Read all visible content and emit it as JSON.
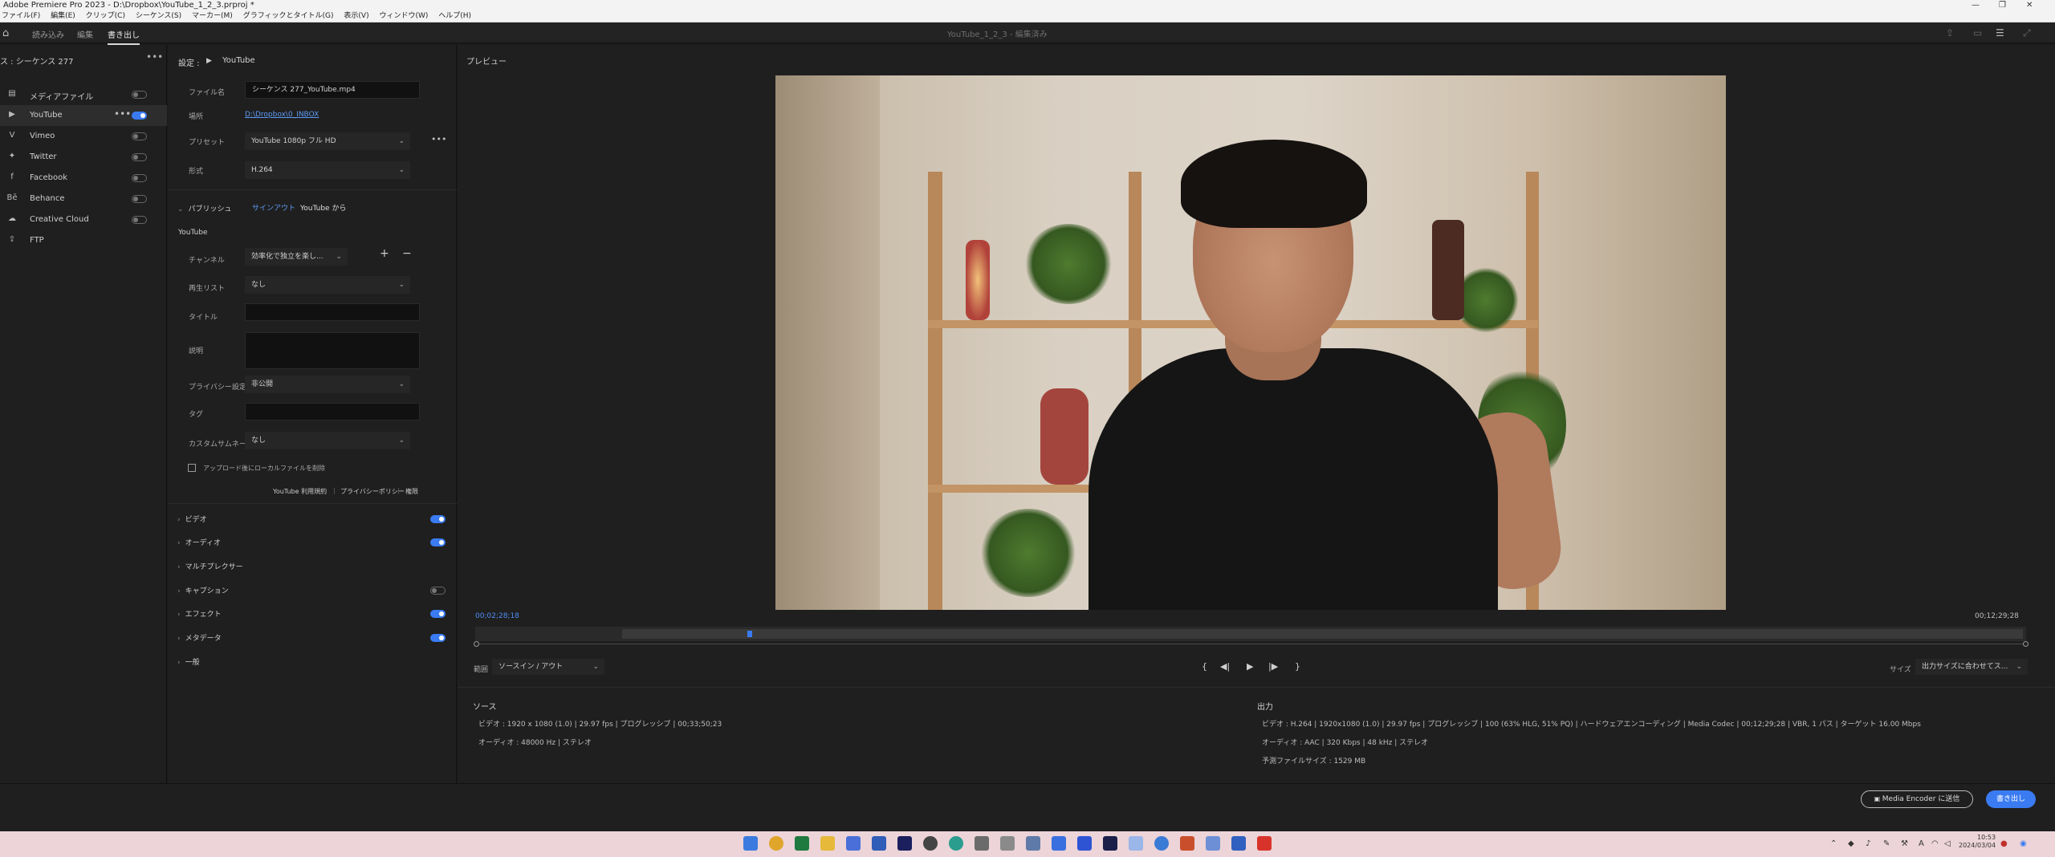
{
  "titlebar": {
    "title": "Adobe Premiere Pro 2023 - D:\\Dropbox\\YouTube_1_2_3.prproj *"
  },
  "menubar": {
    "items": [
      "ファイル(F)",
      "編集(E)",
      "クリップ(C)",
      "シーケンス(S)",
      "マーカー(M)",
      "グラフィックとタイトル(G)",
      "表示(V)",
      "ウィンドウ(W)",
      "ヘルプ(H)"
    ]
  },
  "workspace": {
    "tabs": [
      "読み込み",
      "編集",
      "書き出し"
    ],
    "active": "書き出し",
    "doc_title": "YouTube_1_2_3 - 編集済み"
  },
  "left": {
    "header": "ス : シーケンス 277",
    "destinations": [
      {
        "label": "メディアファイル",
        "icon": "file-icon",
        "toggle": false
      },
      {
        "label": "YouTube",
        "icon": "youtube-icon",
        "toggle": true,
        "active": true
      },
      {
        "label": "Vimeo",
        "icon": "vimeo-icon",
        "toggle": false
      },
      {
        "label": "Twitter",
        "icon": "twitter-icon",
        "toggle": false
      },
      {
        "label": "Facebook",
        "icon": "facebook-icon",
        "toggle": false
      },
      {
        "label": "Behance",
        "icon": "behance-icon",
        "toggle": false
      },
      {
        "label": "Creative Cloud",
        "icon": "creative-cloud-icon",
        "toggle": false
      },
      {
        "label": "FTP",
        "icon": "ftp-icon",
        "toggle": false
      }
    ]
  },
  "settings": {
    "header_prefix": "設定 :",
    "header_dest": "YouTube",
    "filename_label": "ファイル名",
    "filename_value": "シーケンス 277_YouTube.mp4",
    "location_label": "場所",
    "location_value": "D:\\Dropbox\\0_INBOX",
    "preset_label": "プリセット",
    "preset_value": "YouTube 1080p フル HD",
    "format_label": "形式",
    "format_value": "H.264",
    "publish": {
      "section": "パブリッシュ",
      "signout": "サインアウト",
      "from": "YouTube から",
      "sub": "YouTube",
      "channel_label": "チャンネル",
      "channel_value": "効率化で独立を楽し...",
      "playlist_label": "再生リスト",
      "playlist_value": "なし",
      "title_label": "タイトル",
      "desc_label": "説明",
      "privacy_label": "プライバシー設定",
      "privacy_value": "非公開",
      "tag_label": "タグ",
      "thumb_label": "カスタムサムネール",
      "thumb_value": "なし",
      "delete_local": "アップロード後にローカルファイルを削除",
      "links": [
        "YouTube 利用規約",
        "プライバシーポリシー",
        "権限"
      ]
    },
    "sections": [
      {
        "label": "ビデオ",
        "toggle": true
      },
      {
        "label": "オーディオ",
        "toggle": true
      },
      {
        "label": "マルチプレクサー",
        "toggle": null
      },
      {
        "label": "キャプション",
        "toggle": false
      },
      {
        "label": "エフェクト",
        "toggle": true
      },
      {
        "label": "メタデータ",
        "toggle": true
      },
      {
        "label": "一般",
        "toggle": null
      }
    ]
  },
  "preview": {
    "title": "プレビュー",
    "current_time": "00;02;28;18",
    "duration": "00;12;29;28",
    "range_label": "範囲",
    "range_value": "ソースイン / アウト",
    "size_label": "サイズ",
    "size_value": "出力サイズに合わせてス..."
  },
  "source": {
    "heading": "ソース",
    "video": "ビデオ :  1920 x 1080 (1.0)  |  29.97 fps  |  プログレッシブ  |  00;33;50;23",
    "audio": "オーディオ :  48000 Hz  |  ステレオ"
  },
  "output": {
    "heading": "出力",
    "video": "ビデオ :  H.264  |  1920x1080 (1.0)  |  29.97 fps  |  プログレッシブ  |  100 (63% HLG, 51% PQ)  |  ハードウェアエンコーディング  |  Media Codec  |  00;12;29;28  |  VBR, 1 パス  |  ターゲット 16.00 Mbps",
    "audio": "オーディオ :  AAC  |  320 Kbps  |  48 kHz  |  ステレオ",
    "size": "予測ファイルサイズ :  1529 MB"
  },
  "footer": {
    "media_encoder": "Media Encoder に送信",
    "export": "書き出し"
  },
  "taskbar": {
    "time": "10:53",
    "date": "2024/03/04"
  },
  "colors": {
    "accent": "#3a7bf2",
    "panel": "#1f1f1f",
    "taskbar": "#ecd4d8"
  }
}
